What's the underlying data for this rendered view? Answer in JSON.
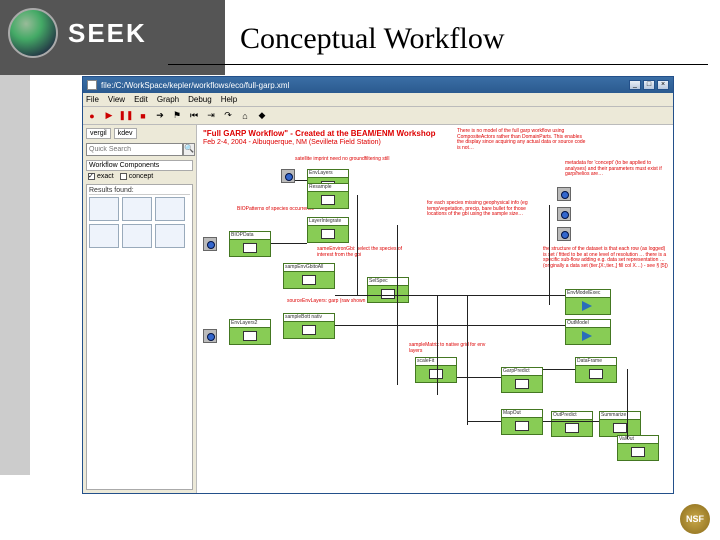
{
  "slide": {
    "title": "Conceptual Workflow",
    "logo_text": "SEEK"
  },
  "window": {
    "title": "file:/C:/WorkSpace/kepler/workflows/eco/full-garp.xml",
    "menu": [
      "File",
      "View",
      "Edit",
      "Graph",
      "Debug",
      "Help"
    ],
    "buttons": {
      "min": "_",
      "max": "□",
      "close": "×"
    }
  },
  "sidebar": {
    "tabs": [
      "vergil",
      "kdev"
    ],
    "search_placeholder": "Quick Search",
    "pane_label": "Workflow Components",
    "checks": {
      "exact": "exact",
      "concept": "concept"
    },
    "results_label": "Results found:"
  },
  "canvas": {
    "title": "\"Full GARP Workflow\" - Created at the BEAM/ENM Workshop",
    "subtitle": "Feb 2-4, 2004 - Albuquerque, NM (Sevilleta Field Station)",
    "notes": {
      "n1": "There is no model of the full garp workflow using CompositeActors rather than DomainParts. This enables the display since acquiring any actual data or source code is not…",
      "n2": "metadata for 'concept' (to be applied to analyses) and their parameters must exist if garp/helios are…",
      "n3": "satellite imprint need no groundfiltering still",
      "n4": "BIOPatterns of species occurrence",
      "n5": "for each species missing geophysical info (eg temp/vegetation, precip, bare bullet for those locations of the gbi using the sample size…",
      "n6": "the structure of the dataset is that each row (as logged) is set / fitted to be at one level of resolution … there is a specific sub-flow adding e.g. data set representation … (originally a data set (tier.[X:,tier.,] fill col X…) - see § [5])",
      "n7": "sameEnvironGbi: select the species of interest from the gbi",
      "n8": "sampleMatrix to native grid for env layers",
      "n9": "sourceEnvLayers: garp (raw shown in lite gbi - now)"
    },
    "actors": {
      "a1": "EnvLayers",
      "a2": "Resample",
      "a3": "LayerIntegrate",
      "a4": "BIOPData",
      "a5": "sampEnvGbitoAll",
      "a6": "SelSpec",
      "a7": "sampleBott nativ",
      "a8": "EnvModelExec",
      "a9": "OutModel",
      "a10": "EnvLayers2",
      "a11": "GarpPredict",
      "a12": "MapOut",
      "a13": "scaleFit",
      "a14": "OutPredict",
      "a15": "Summarize",
      "a16": "DataFrame",
      "a17": "ValOut"
    }
  },
  "footer": {
    "nsf": "NSF"
  }
}
